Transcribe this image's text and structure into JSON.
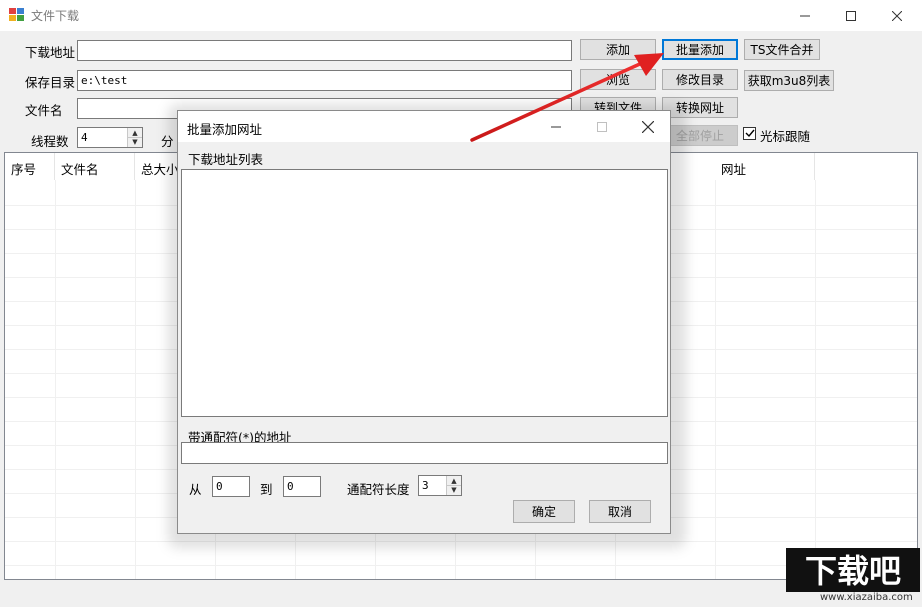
{
  "window": {
    "title": "文件下载",
    "controls": [
      "minimize-icon",
      "maximize-icon",
      "close-icon"
    ]
  },
  "form": {
    "url_label": "下载地址",
    "url_value": "",
    "save_dir_label": "保存目录",
    "save_dir_value": "e:\\test",
    "filename_label": "文件名",
    "filename_value": "",
    "threads_label": "线程数",
    "threads_value": "4",
    "chunk_label_partial": "分",
    "cursor_follow_label": "光标跟随",
    "cursor_follow_checked": true
  },
  "buttons": {
    "add": "添加",
    "batch_add": "批量添加",
    "ts_merge": "TS文件合并",
    "browse": "浏览",
    "change_dir": "修改目录",
    "get_m3u8": "获取m3u8列表",
    "to_file": "转到文件",
    "convert_url": "转换网址",
    "stop_all": "全部停止"
  },
  "list": {
    "columns": [
      "序号",
      "文件名",
      "总大小",
      "网址"
    ],
    "rows": []
  },
  "dialog": {
    "title": "批量添加网址",
    "url_list_label": "下载地址列表",
    "url_list_value": "",
    "wildcard_label": "带通配符(*)的地址",
    "wildcard_value": "",
    "from_label": "从",
    "from_value": "0",
    "to_label": "到",
    "to_value": "0",
    "wildcard_len_label": "通配符长度",
    "wildcard_len_value": "3",
    "ok": "确定",
    "cancel": "取消"
  },
  "watermark": {
    "logo_text": "下载吧",
    "url": "www.xiazaiba.com"
  },
  "colors": {
    "accent": "#0078d7",
    "arrow": "#e02020"
  }
}
